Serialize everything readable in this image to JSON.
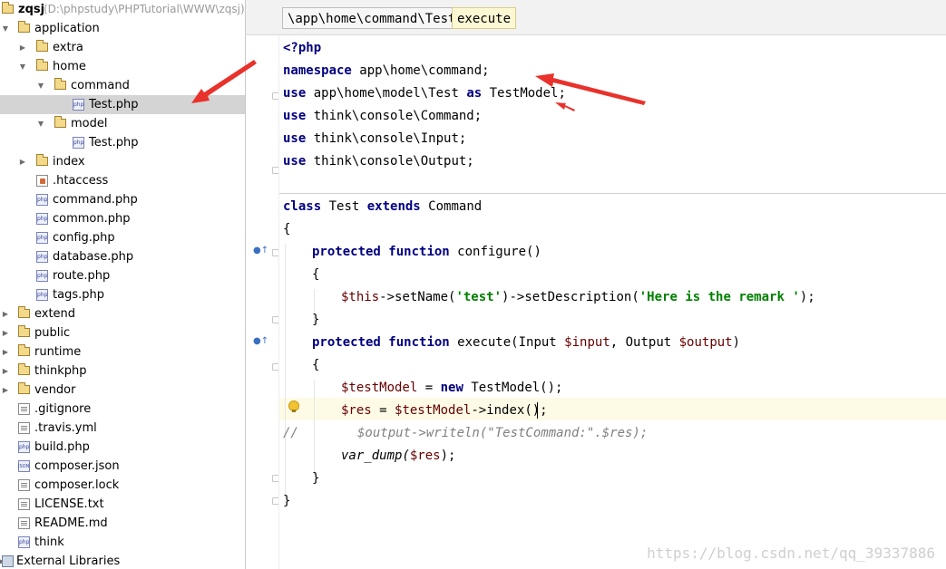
{
  "project": {
    "root_name": "zqsj",
    "root_path": "(D:\\phpstudy\\PHPTutorial\\WWW\\zqsj)",
    "items": [
      {
        "label": "application",
        "type": "folder",
        "expanded": true
      },
      {
        "label": "extra",
        "type": "folder",
        "expanded": false
      },
      {
        "label": "home",
        "type": "folder",
        "expanded": true
      },
      {
        "label": "command",
        "type": "folder",
        "expanded": true
      },
      {
        "label": "Test.php",
        "type": "php",
        "selected": true
      },
      {
        "label": "model",
        "type": "folder",
        "expanded": true
      },
      {
        "label": "Test.php",
        "type": "php"
      },
      {
        "label": "index",
        "type": "folder",
        "expanded": false
      },
      {
        "label": ".htaccess",
        "type": "htaccess"
      },
      {
        "label": "command.php",
        "type": "php"
      },
      {
        "label": "common.php",
        "type": "php"
      },
      {
        "label": "config.php",
        "type": "php"
      },
      {
        "label": "database.php",
        "type": "php"
      },
      {
        "label": "route.php",
        "type": "php"
      },
      {
        "label": "tags.php",
        "type": "php"
      },
      {
        "label": "extend",
        "type": "folder",
        "expanded": false
      },
      {
        "label": "public",
        "type": "folder",
        "expanded": false
      },
      {
        "label": "runtime",
        "type": "folder",
        "expanded": false
      },
      {
        "label": "thinkphp",
        "type": "folder",
        "expanded": false
      },
      {
        "label": "vendor",
        "type": "folder",
        "expanded": false
      },
      {
        "label": ".gitignore",
        "type": "text"
      },
      {
        "label": ".travis.yml",
        "type": "text"
      },
      {
        "label": "build.php",
        "type": "php"
      },
      {
        "label": "composer.json",
        "type": "json"
      },
      {
        "label": "composer.lock",
        "type": "text"
      },
      {
        "label": "LICENSE.txt",
        "type": "text"
      },
      {
        "label": "README.md",
        "type": "text"
      },
      {
        "label": "think",
        "type": "php"
      },
      {
        "label": "External Libraries",
        "type": "library",
        "expanded": false
      }
    ]
  },
  "breadcrumb": {
    "path": "\\app\\home\\command\\Test",
    "method": "execute"
  },
  "code": {
    "l1": "<?php",
    "l2_kw": "namespace",
    "l2_rest": " app\\home\\command;",
    "l3_kw": "use",
    "l3_a": " app\\home\\model\\Test ",
    "l3_as": "as",
    "l3_b": " TestModel;",
    "l4_kw": "use",
    "l4_rest": " think\\console\\Command;",
    "l5_kw": "use",
    "l5_rest": " think\\console\\Input;",
    "l6_kw": "use",
    "l6_rest": " think\\console\\Output;",
    "l8_kw1": "class",
    "l8_a": " Test ",
    "l8_kw2": "extends",
    "l8_b": " Command",
    "l9": "{",
    "l10_kw1": "protected",
    "l10_kw2": "function",
    "l10_rest": " configure()",
    "l11": "{",
    "l12_var": "$this",
    "l12_a": "->setName(",
    "l12_str1": "'test'",
    "l12_b": ")->setDescription(",
    "l12_str2": "'Here is the remark '",
    "l12_c": ");",
    "l13": "}",
    "l14_kw1": "protected",
    "l14_kw2": "function",
    "l14_a": " execute(Input ",
    "l14_v1": "$input",
    "l14_b": ", Output ",
    "l14_v2": "$output",
    "l14_c": ")",
    "l15": "{",
    "l16_var": "$testModel",
    "l16_a": " = ",
    "l16_kw": "new",
    "l16_b": " TestModel();",
    "l17_v1": "$res",
    "l17_a": " = ",
    "l17_v2": "$testModel",
    "l17_b": "->index();",
    "l18_slashes": "//",
    "l18_rest": "$output->writeln(\"TestCommand:\".$res);",
    "l19_a": "var_dump(",
    "l19_var": "$res",
    "l19_b": ");",
    "l20": "}",
    "l21": "}"
  },
  "watermark": "https://blog.csdn.net/qq_39337886",
  "colors": {
    "keyword": "#000080",
    "variable": "#660000",
    "string": "#008000",
    "comment": "#808080",
    "arrow": "#e8322b"
  }
}
